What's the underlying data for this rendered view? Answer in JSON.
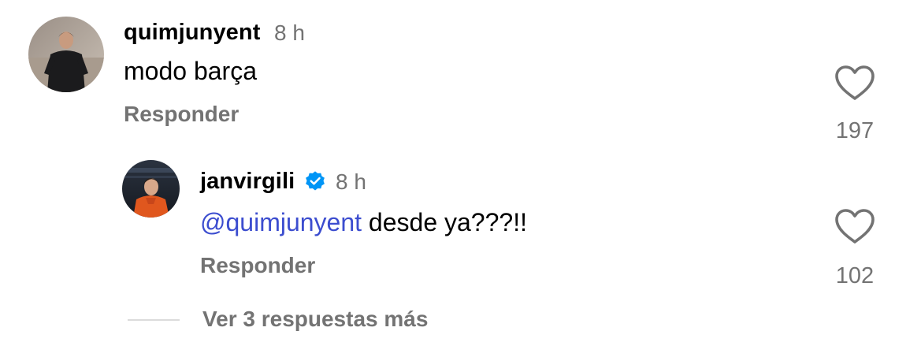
{
  "comments": [
    {
      "username": "quimjunyent",
      "time": "8 h",
      "text": "modo barça",
      "reply_label": "Responder",
      "likes": "197",
      "avatar": "avatar-player-black-kit",
      "verified": false
    }
  ],
  "replies": [
    {
      "username": "janvirgili",
      "time": "8 h",
      "mention": "@quimjunyent",
      "text": " desde ya???!!",
      "reply_label": "Responder",
      "likes": "102",
      "avatar": "avatar-player-orange-kit",
      "verified": true
    }
  ],
  "more_replies_label": "Ver 3 respuestas más",
  "colors": {
    "secondary_text": "#737373",
    "mention": "#3c4dcf",
    "verified_badge": "#0095f6",
    "divider": "#dbdbdb"
  },
  "icons": {
    "like": "heart-outline-icon",
    "verified": "verified-badge-icon"
  }
}
